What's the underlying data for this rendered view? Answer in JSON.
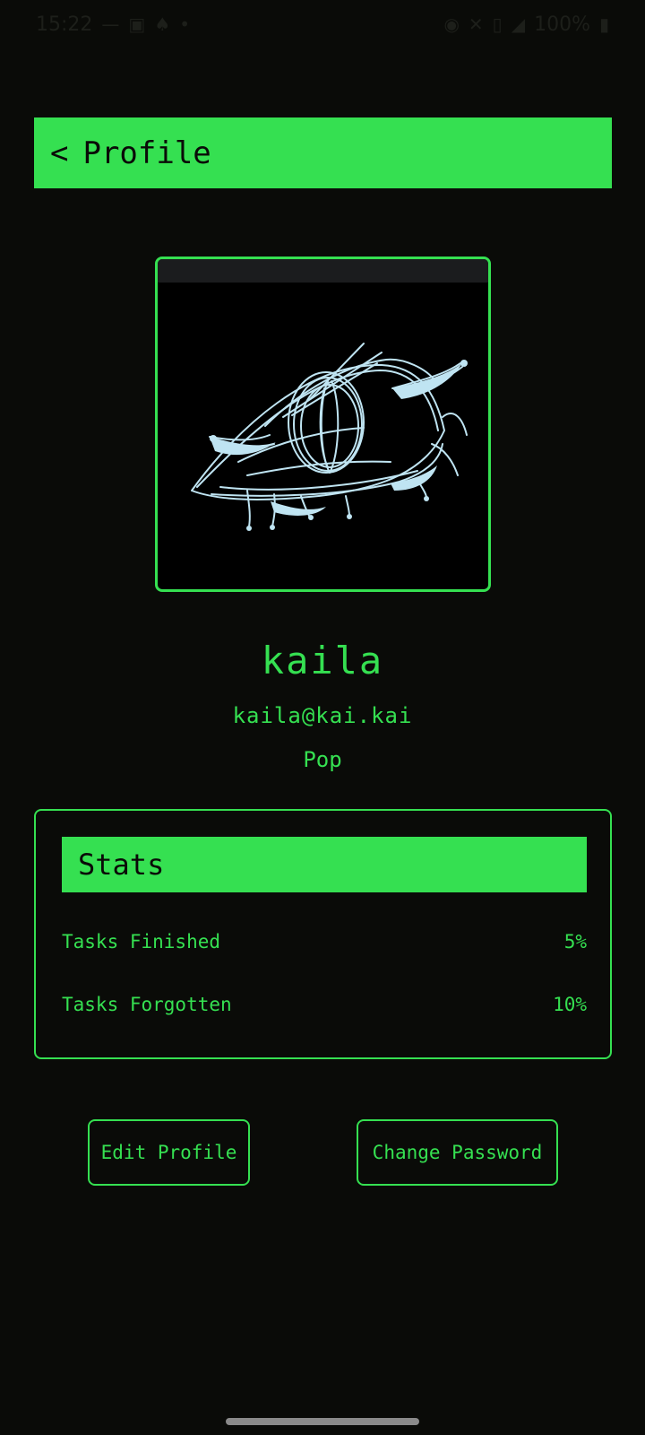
{
  "status_bar": {
    "time": "15:22",
    "battery": "100%",
    "left_icons": [
      "dash-icon",
      "gallery-icon",
      "notification-icon",
      "dot-icon"
    ],
    "right_icons": [
      "alarm-icon",
      "mute-icon",
      "vibrate-icon",
      "wifi-icon",
      "battery-icon"
    ]
  },
  "header": {
    "back_label": "<",
    "title": "Profile"
  },
  "user": {
    "name": "kaila",
    "email": "kaila@kai.kai",
    "role": "Pop"
  },
  "stats": {
    "title": "Stats",
    "rows": [
      {
        "label": "Tasks Finished",
        "value": "5%"
      },
      {
        "label": "Tasks Forgotten",
        "value": "10%"
      }
    ]
  },
  "buttons": {
    "edit_profile": "Edit Profile",
    "change_password": "Change Password"
  },
  "colors": {
    "accent": "#35e051",
    "background": "#0a0b08",
    "sketch": "#bfe4f2"
  }
}
